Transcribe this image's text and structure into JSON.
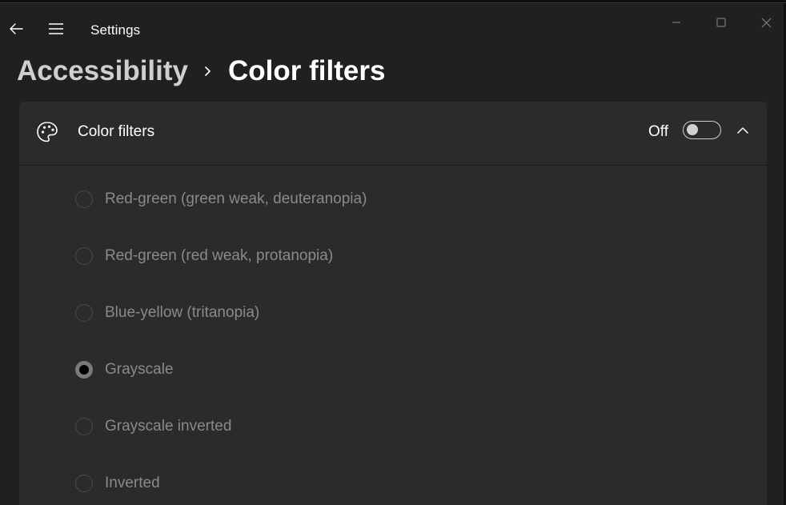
{
  "window": {
    "app_title": "Settings",
    "controls": {
      "minimize_icon": "minimize-icon",
      "maximize_icon": "maximize-icon",
      "close_icon": "close-icon"
    }
  },
  "nav": {
    "back_icon": "back-arrow-icon",
    "menu_icon": "hamburger-menu-icon"
  },
  "breadcrumb": {
    "parent": "Accessibility",
    "separator_icon": "chevron-right-icon",
    "current": "Color filters"
  },
  "color_filters_card": {
    "icon": "palette-icon",
    "title": "Color filters",
    "toggle": {
      "state_label": "Off",
      "is_on": false
    },
    "collapse_icon": "chevron-up-icon",
    "options": [
      {
        "label": "Red-green (green weak, deuteranopia)",
        "selected": false
      },
      {
        "label": "Red-green (red weak, protanopia)",
        "selected": false
      },
      {
        "label": "Blue-yellow (tritanopia)",
        "selected": false
      },
      {
        "label": "Grayscale",
        "selected": true
      },
      {
        "label": "Grayscale inverted",
        "selected": false
      },
      {
        "label": "Inverted",
        "selected": false
      }
    ],
    "disabled": true
  },
  "colors": {
    "background": "#202020",
    "card": "#2b2b2b",
    "text_primary": "#ffffff",
    "text_disabled": "#8a8a8a"
  }
}
